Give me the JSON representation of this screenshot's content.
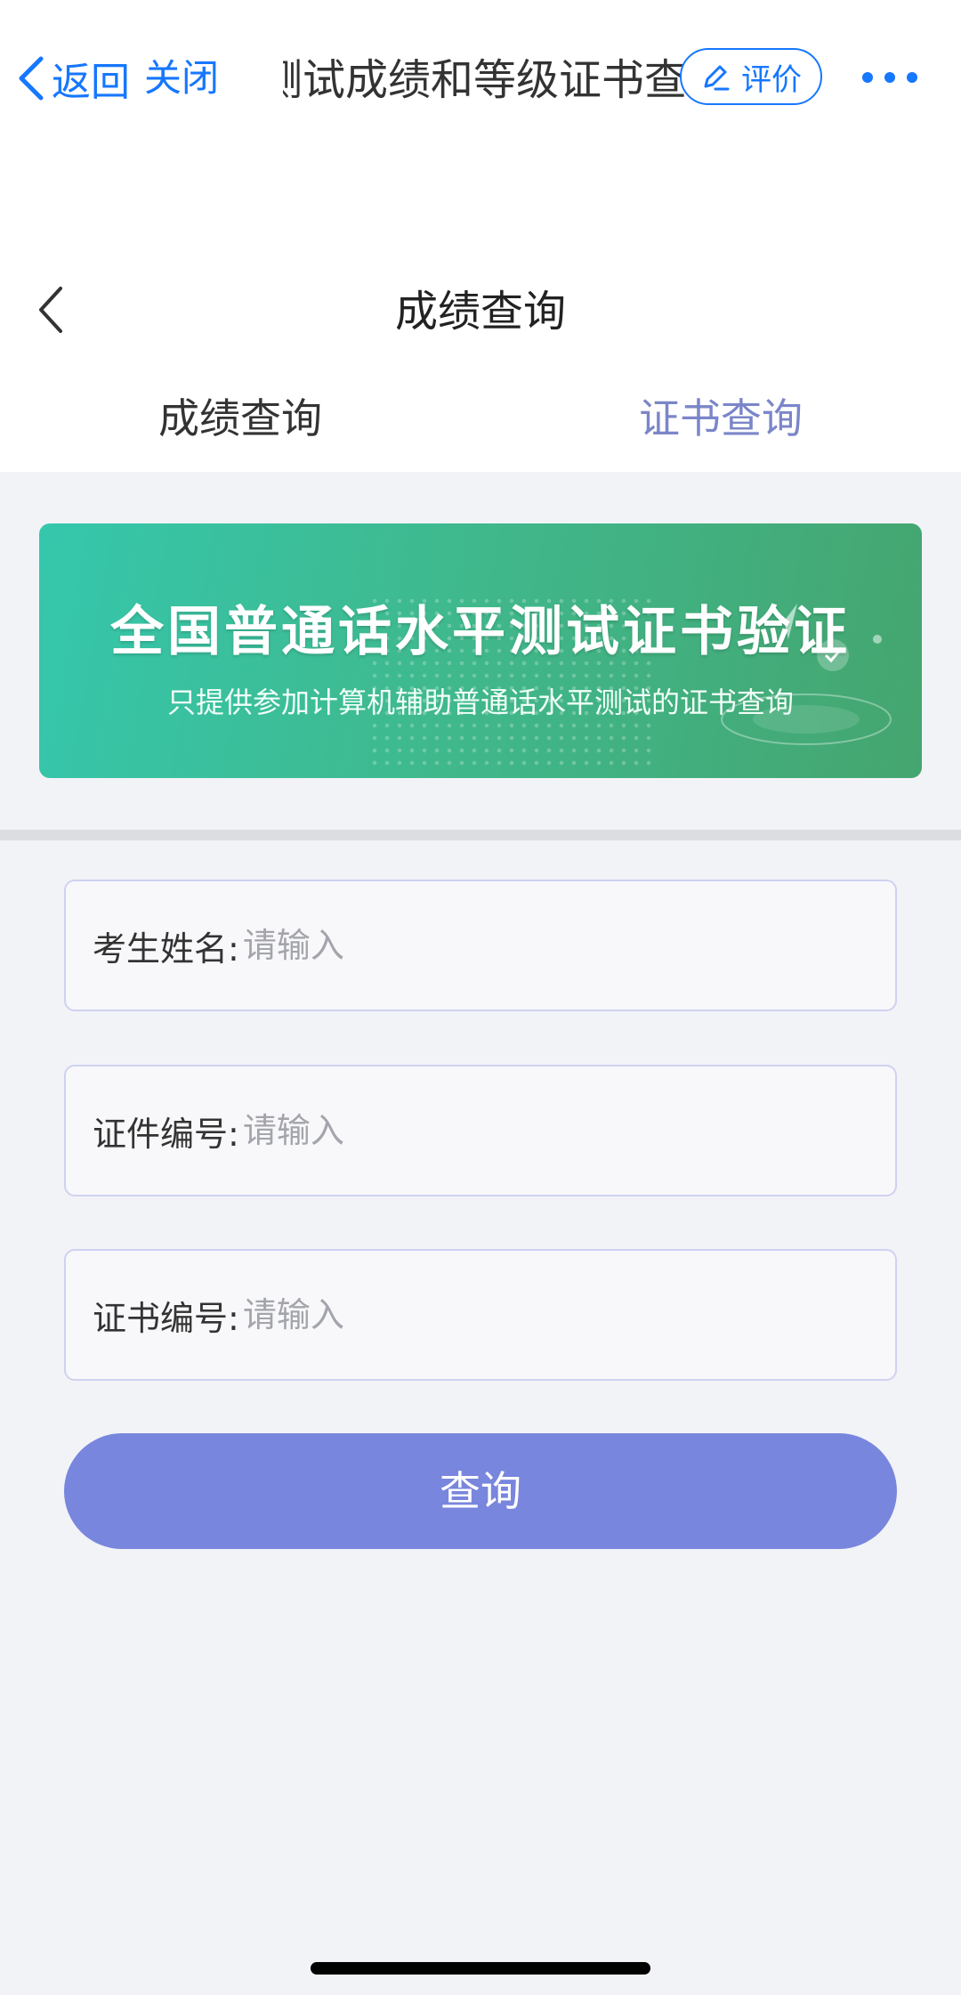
{
  "header": {
    "back_label": "返回",
    "close_label": "关闭",
    "title": "测试成绩和等级证书查询",
    "rate_label": "评价",
    "accent_color": "#1677ff"
  },
  "page": {
    "title": "成绩查询",
    "tabs": [
      {
        "label": "成绩查询",
        "active": false
      },
      {
        "label": "证书查询",
        "active": true
      }
    ]
  },
  "banner": {
    "title": "全国普通话水平测试证书验证",
    "subtitle": "只提供参加计算机辅助普通话水平测试的证书查询"
  },
  "form": {
    "fields": [
      {
        "label": "考生姓名:",
        "placeholder": "请输入",
        "value": ""
      },
      {
        "label": "证件编号:",
        "placeholder": "请输入",
        "value": ""
      },
      {
        "label": "证书编号:",
        "placeholder": "请输入",
        "value": ""
      }
    ],
    "submit_label": "查询",
    "submit_color": "#7986dd"
  },
  "icons": [
    "chevron-left-icon",
    "edit-pen-icon",
    "more-dots-icon"
  ]
}
